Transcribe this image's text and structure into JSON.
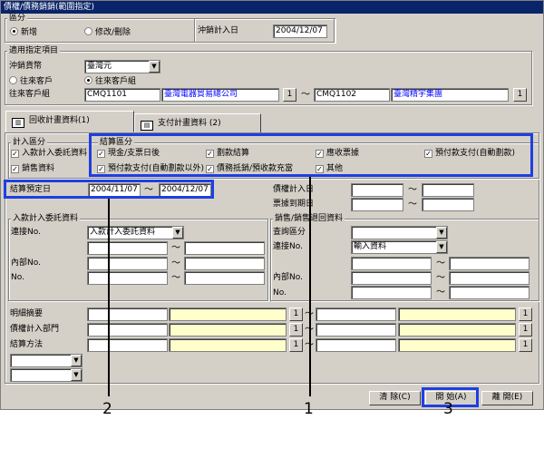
{
  "window": {
    "title": "債權/債務銷銷(範圍指定)"
  },
  "section": {
    "legend": "區分",
    "radio_new": "新增",
    "radio_edit": "修改/刪除",
    "date_label": "沖銷計入日",
    "date_value": "2004/12/07"
  },
  "scope": {
    "legend": "適用指定項目",
    "currency_label": "沖銷貨幣",
    "currency_value": "臺灣元",
    "radio_customer": "往來客戶",
    "radio_group": "往來客戶組",
    "group_label": "往來客戶組",
    "from_code": "CMQ1101",
    "from_name": "臺灣電器貿易總公司",
    "to_code": "CMQ1102",
    "to_name": "臺灣精宇集團",
    "lookup_button": "1",
    "range_tilde": "～"
  },
  "tabs": [
    {
      "label": "回收計畫資料(1)"
    },
    {
      "label": "支付計畫資料 (2)"
    }
  ],
  "calc": {
    "legend": "計入區分",
    "opt1": "入款計入委託資料",
    "opt2": "銷售資料"
  },
  "settle": {
    "legend": "結算區分",
    "items": [
      "現金/支票日後",
      "劃款結算",
      "應收票據",
      "預付款支付(自動劃款)",
      "預付款支付(自動劃款以外)",
      "債務抵銷/預收款充當",
      "其他"
    ]
  },
  "date_range": {
    "label": "結算預定日",
    "from": "2004/11/07",
    "to": "2004/12/07"
  },
  "right_top": {
    "debt_label": "債權計入日",
    "ticket_label": "票據到期日"
  },
  "left_panel": {
    "legend": "入款計入委託資料",
    "contact_label": "連接No.",
    "contact_value": "入款計入委託資料",
    "internal_label": "內部No.",
    "no_label": "No."
  },
  "right_panel": {
    "legend": "銷售/銷售退回資料",
    "query_label": "查詢區分",
    "contact_label": "連接No.",
    "contact_value": "輸入資料",
    "internal_label": "內部No.",
    "no_label": "No."
  },
  "bottom": {
    "detail_label": "明細摘要",
    "dept_label": "債權計入部門",
    "method_label": "結算方法"
  },
  "footer": {
    "clear": "清 除(C)",
    "start": "開 始(A)",
    "close": "離 開(E)"
  },
  "callouts": [
    "1",
    "2",
    "3"
  ],
  "colors": {
    "highlight": "#1f3fe0",
    "field_yellow": "#ffffcc",
    "link_blue": "#0000ff"
  }
}
